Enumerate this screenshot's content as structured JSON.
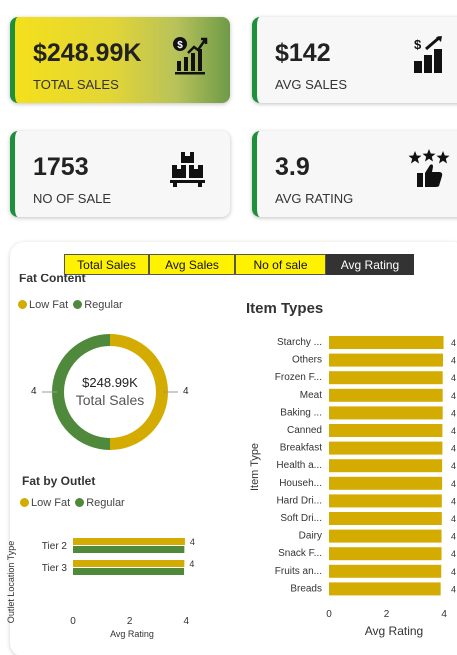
{
  "kpis": [
    {
      "value": "$248.99K",
      "label": "TOTAL SALES",
      "icon": "sales-chart-icon"
    },
    {
      "value": "$142",
      "label": "AVG SALES",
      "icon": "dollar-bar-icon"
    },
    {
      "value": "1753",
      "label": "NO OF SALE",
      "icon": "boxes-icon"
    },
    {
      "value": "3.9",
      "label": "AVG RATING",
      "icon": "stars-thumb-icon"
    }
  ],
  "buttons": [
    "Total Sales",
    "Avg Sales",
    "No of sale",
    "Avg Rating"
  ],
  "active_button": "Avg Rating",
  "colors": {
    "low_fat": "#d4ab00",
    "regular": "#4f8a3c",
    "accent": "#1e8f3a"
  },
  "fat_content": {
    "title": "Fat Content",
    "legend": [
      "Low Fat",
      "Regular"
    ],
    "center_value": "$248.99K",
    "center_label": "Total Sales",
    "left_label": "4",
    "right_label": "4"
  },
  "fat_by_outlet": {
    "title": "Fat by Outlet",
    "legend": [
      "Low Fat",
      "Regular"
    ],
    "ylabel": "Outlet Location Type",
    "xlabel": "Avg Rating"
  },
  "item_types": {
    "title": "Item Types",
    "ylabel": "Item Type",
    "xlabel": "Avg Rating"
  },
  "chart_data": [
    {
      "type": "pie",
      "title": "Fat Content",
      "labels": [
        "Low Fat",
        "Regular"
      ],
      "values": [
        4,
        4
      ]
    },
    {
      "type": "bar",
      "title": "Fat by Outlet",
      "categories": [
        "Tier 2",
        "Tier 3"
      ],
      "series": [
        {
          "name": "Low Fat",
          "values": [
            3.95,
            3.93
          ]
        },
        {
          "name": "Regular",
          "values": [
            3.93,
            3.92
          ]
        }
      ],
      "data_labels": [
        "4",
        "4"
      ],
      "xticks": [
        "0",
        "2",
        "4"
      ],
      "xlim": [
        0,
        4.2
      ],
      "xlabel": "Avg Rating",
      "ylabel": "Outlet Location Type"
    },
    {
      "type": "bar",
      "title": "Item Types",
      "categories": [
        "Starchy ...",
        "Others",
        "Frozen F...",
        "Meat",
        "Baking ...",
        "Canned",
        "Breakfast",
        "Health a...",
        "Househ...",
        "Hard Dri...",
        "Soft Dri...",
        "Dairy",
        "Snack F...",
        "Fruits an...",
        "Breads"
      ],
      "values": [
        3.98,
        3.96,
        3.95,
        3.95,
        3.95,
        3.94,
        3.94,
        3.93,
        3.93,
        3.92,
        3.92,
        3.91,
        3.91,
        3.9,
        3.88
      ],
      "data_labels": [
        "4",
        "4",
        "4",
        "4",
        "4",
        "4",
        "4",
        "4",
        "4",
        "4",
        "4",
        "4",
        "4",
        "4",
        "4"
      ],
      "xticks": [
        "0",
        "2",
        "4"
      ],
      "xlim": [
        0,
        4.1
      ],
      "xlabel": "Avg Rating",
      "ylabel": "Item Type"
    }
  ]
}
